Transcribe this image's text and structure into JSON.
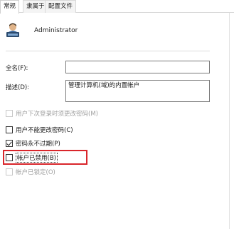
{
  "tabs": [
    {
      "label": "常规"
    },
    {
      "label": "隶属于"
    },
    {
      "label": "配置文件"
    }
  ],
  "user": {
    "name": "Administrator",
    "icon": "user-account-icon"
  },
  "fields": {
    "fullname_label": "全名(F):",
    "fullname_value": "",
    "description_label": "描述(D):",
    "description_value": "管理计算机(域)的内置帐户"
  },
  "checkboxes": [
    {
      "label": "用户下次登录时须更改密码(M)",
      "checked": false,
      "enabled": false
    },
    {
      "label": "用户不能更改密码(C)",
      "checked": false,
      "enabled": true
    },
    {
      "label": "密码永不过期(P)",
      "checked": true,
      "enabled": true
    },
    {
      "label": "帐户已禁用(B)",
      "checked": false,
      "enabled": true
    },
    {
      "label": "帐户已锁定(O)",
      "checked": false,
      "enabled": false
    }
  ],
  "colors": {
    "highlight": "#d9262b"
  }
}
